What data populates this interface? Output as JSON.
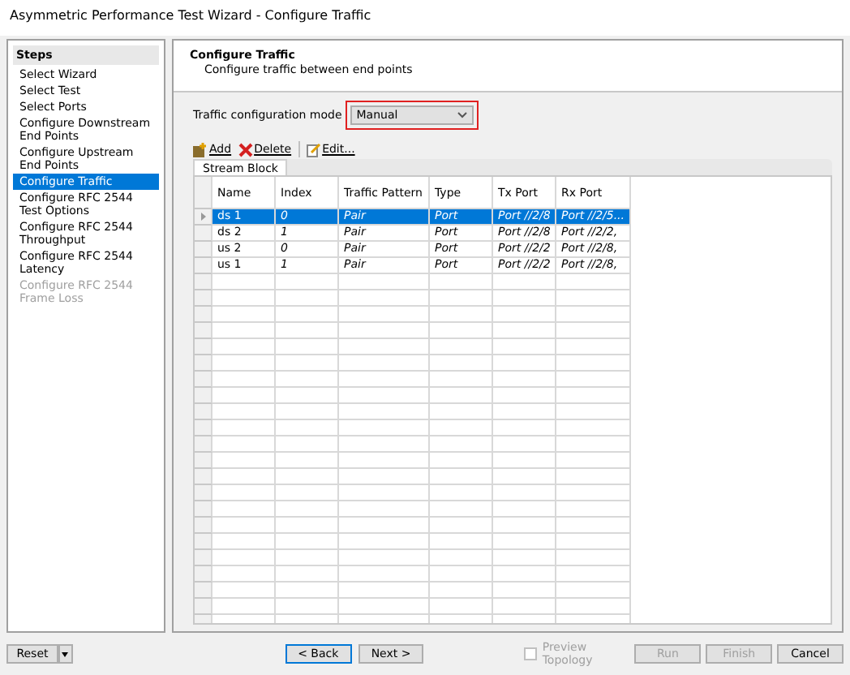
{
  "window": {
    "title": "Asymmetric Performance Test Wizard - Configure Traffic"
  },
  "steps": {
    "title": "Steps",
    "items": [
      {
        "label": "Select Wizard",
        "selected": false,
        "disabled": false
      },
      {
        "label": "Select Test",
        "selected": false,
        "disabled": false
      },
      {
        "label": "Select Ports",
        "selected": false,
        "disabled": false
      },
      {
        "label": "Configure Downstream End Points",
        "selected": false,
        "disabled": false
      },
      {
        "label": "Configure Upstream End Points",
        "selected": false,
        "disabled": false
      },
      {
        "label": "Configure Traffic",
        "selected": true,
        "disabled": false
      },
      {
        "label": "Configure RFC 2544 Test Options",
        "selected": false,
        "disabled": false
      },
      {
        "label": "Configure RFC 2544 Throughput",
        "selected": false,
        "disabled": false
      },
      {
        "label": "Configure RFC 2544 Latency",
        "selected": false,
        "disabled": false
      },
      {
        "label": "Configure RFC 2544 Frame Loss",
        "selected": false,
        "disabled": true
      }
    ]
  },
  "header": {
    "title": "Configure Traffic",
    "subtitle": "Configure traffic between end points"
  },
  "mode": {
    "label": "Traffic configuration mode",
    "value": "Manual"
  },
  "toolbar": [
    {
      "label": "Add",
      "kind": "add"
    },
    {
      "label": "Delete",
      "kind": "delete"
    },
    {
      "label": "Edit...",
      "kind": "edit"
    }
  ],
  "tabs": [
    {
      "label": "Stream Block",
      "selected": true
    }
  ],
  "table": {
    "columns": [
      "Name",
      "Index",
      "Traffic Pattern",
      "Type",
      "Tx Port",
      "Rx Port"
    ],
    "rows": [
      {
        "selected": true,
        "cells": [
          "ds 1",
          "0",
          "Pair",
          "Port",
          "Port //2/8",
          "Port //2/5..."
        ]
      },
      {
        "selected": false,
        "cells": [
          "ds 2",
          "1",
          "Pair",
          "Port",
          "Port //2/8",
          "Port //2/2,"
        ]
      },
      {
        "selected": false,
        "cells": [
          "us 2",
          "0",
          "Pair",
          "Port",
          "Port //2/2",
          "Port //2/8,"
        ]
      },
      {
        "selected": false,
        "cells": [
          "us 1",
          "1",
          "Pair",
          "Port",
          "Port //2/2",
          "Port //2/8,"
        ]
      }
    ]
  },
  "footer": {
    "reset": "Reset",
    "back": "< Back",
    "next": "Next >",
    "preview": {
      "label": "Preview Topology",
      "checked": false,
      "disabled": true
    },
    "buttons": [
      {
        "label": "Run",
        "disabled": true
      },
      {
        "label": "Finish",
        "disabled": true
      },
      {
        "label": "Cancel",
        "disabled": false
      }
    ]
  }
}
